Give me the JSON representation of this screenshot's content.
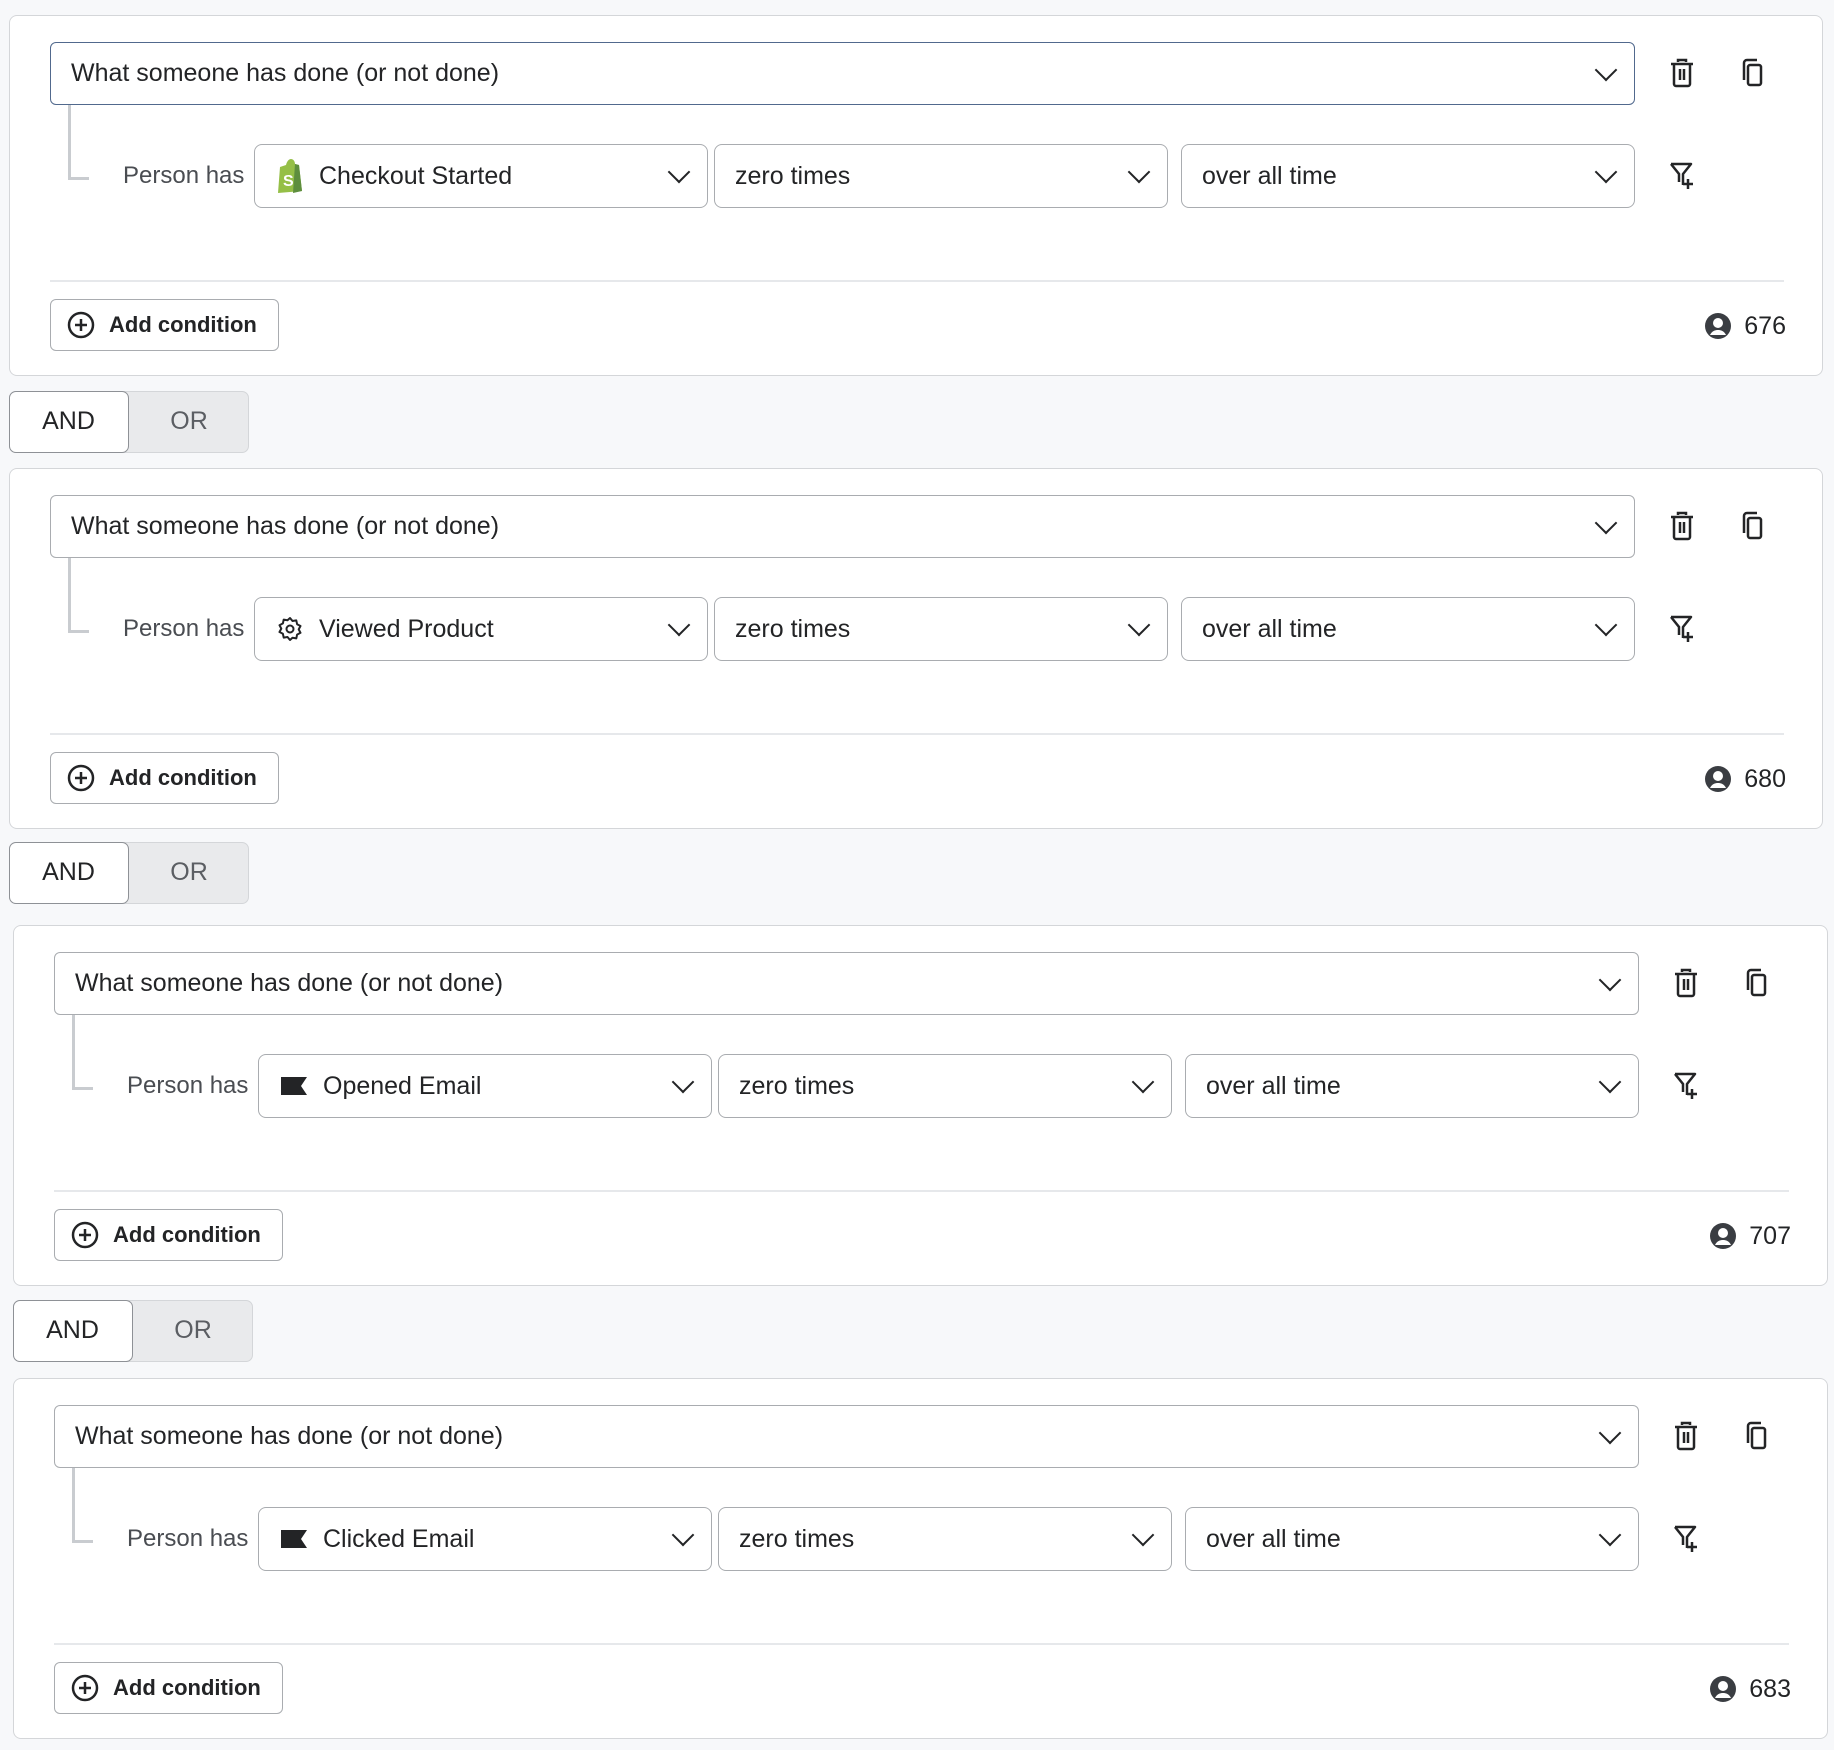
{
  "groups": [
    {
      "main_select": "What someone has done (or not done)",
      "person_has_label": "Person has",
      "metric": {
        "label": "Checkout Started",
        "icon": "shopify-icon"
      },
      "frequency": "zero times",
      "timeframe": "over all time",
      "add_condition_label": "Add condition",
      "count": "676"
    },
    {
      "main_select": "What someone has done (or not done)",
      "person_has_label": "Person has",
      "metric": {
        "label": "Viewed Product",
        "icon": "gear-icon"
      },
      "frequency": "zero times",
      "timeframe": "over all time",
      "add_condition_label": "Add condition",
      "count": "680"
    },
    {
      "main_select": "What someone has done (or not done)",
      "person_has_label": "Person has",
      "metric": {
        "label": "Opened Email",
        "icon": "flag-icon"
      },
      "frequency": "zero times",
      "timeframe": "over all time",
      "add_condition_label": "Add condition",
      "count": "707"
    },
    {
      "main_select": "What someone has done (or not done)",
      "person_has_label": "Person has",
      "metric": {
        "label": "Clicked Email",
        "icon": "flag-icon"
      },
      "frequency": "zero times",
      "timeframe": "over all time",
      "add_condition_label": "Add condition",
      "count": "683"
    }
  ],
  "toggles": [
    {
      "and_label": "AND",
      "or_label": "OR",
      "selected": "AND"
    },
    {
      "and_label": "AND",
      "or_label": "OR",
      "selected": "AND"
    },
    {
      "and_label": "AND",
      "or_label": "OR",
      "selected": "AND"
    }
  ],
  "colors": {
    "shopify_green": "#95bf47",
    "focus_border": "#51698d"
  }
}
